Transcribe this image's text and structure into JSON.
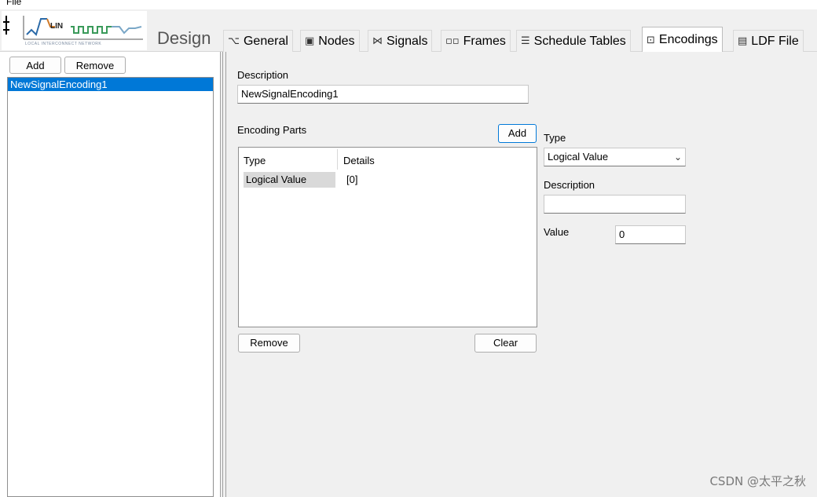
{
  "menu": {
    "file_label": "File"
  },
  "logo": {
    "brand_mark": "┴\nT",
    "brand_text": "LIN",
    "tagline": "LOCAL INTERCONNECT NETWORK"
  },
  "header": {
    "section_label": "Design"
  },
  "tabs": [
    {
      "label": "General",
      "icon": "⌥"
    },
    {
      "label": "Nodes",
      "icon": "▣"
    },
    {
      "label": "Signals",
      "icon": "⋈"
    },
    {
      "label": "Frames",
      "icon": "▫▫"
    },
    {
      "label": "Schedule Tables",
      "icon": "☰"
    },
    {
      "label": "Encodings",
      "icon": "⊡"
    },
    {
      "label": "LDF File",
      "icon": "▤"
    }
  ],
  "left": {
    "add_label": "Add",
    "remove_label": "Remove",
    "items": [
      "NewSignalEncoding1"
    ]
  },
  "content": {
    "description_label": "Description",
    "description_value": "NewSignalEncoding1",
    "encoding_parts_label": "Encoding Parts",
    "add_label": "Add",
    "table": {
      "headers": [
        "Type",
        "Details"
      ],
      "rows": [
        {
          "type": "Logical Value",
          "details": "[0]"
        }
      ]
    },
    "remove_label": "Remove",
    "clear_label": "Clear",
    "type_label": "Type",
    "type_value": "Logical Value",
    "part_description_label": "Description",
    "part_description_value": "",
    "value_label": "Value",
    "value_value": "0"
  },
  "watermark": "CSDN @太平之秋"
}
